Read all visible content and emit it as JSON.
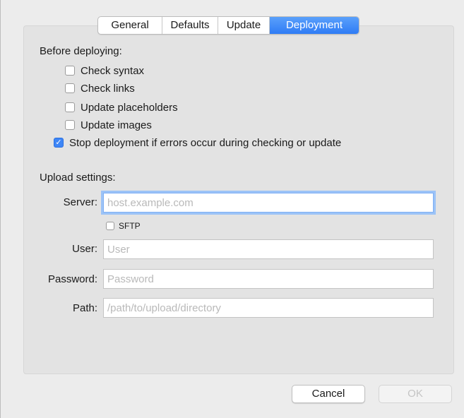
{
  "tabs": [
    {
      "label": "General",
      "selected": false
    },
    {
      "label": "Defaults",
      "selected": false
    },
    {
      "label": "Update",
      "selected": false
    },
    {
      "label": "Deployment",
      "selected": true
    }
  ],
  "before_deploying": {
    "heading": "Before deploying:",
    "options": [
      {
        "label": "Check syntax",
        "checked": false
      },
      {
        "label": "Check links",
        "checked": false
      },
      {
        "label": "Update placeholders",
        "checked": false
      },
      {
        "label": "Update images",
        "checked": false
      },
      {
        "label": "Stop deployment if errors occur during checking or update",
        "checked": true
      }
    ]
  },
  "upload": {
    "heading": "Upload settings:",
    "server": {
      "label": "Server:",
      "placeholder": "host.example.com",
      "value": ""
    },
    "sftp": {
      "label": "SFTP",
      "checked": false
    },
    "user": {
      "label": "User:",
      "placeholder": "User",
      "value": ""
    },
    "password": {
      "label": "Password:",
      "placeholder": "Password",
      "value": ""
    },
    "path": {
      "label": "Path:",
      "placeholder": "/path/to/upload/directory",
      "value": ""
    }
  },
  "buttons": {
    "cancel": "Cancel",
    "ok": "OK"
  },
  "colors": {
    "accent": "#3e86f6",
    "focus_ring": "#9cc3f7",
    "panel": "#e3e3e3",
    "window": "#ececec"
  },
  "icons": {
    "checkmark": "checkmark-icon"
  }
}
